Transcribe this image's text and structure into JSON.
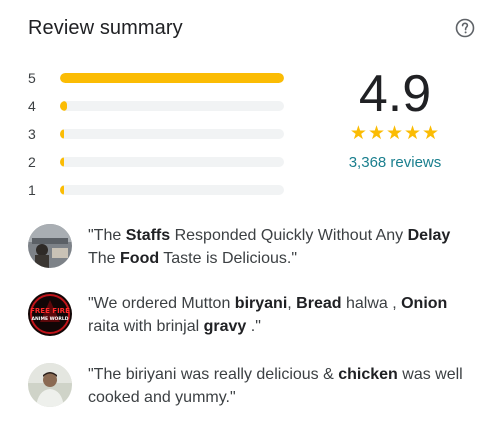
{
  "header": {
    "title": "Review summary",
    "help_icon": "question-circle-icon"
  },
  "rating_distribution": [
    {
      "stars": "5",
      "fraction": 1.0
    },
    {
      "stars": "4",
      "fraction": 0.03
    },
    {
      "stars": "3",
      "fraction": 0.005
    },
    {
      "stars": "2",
      "fraction": 0.005
    },
    {
      "stars": "1",
      "fraction": 0.005
    }
  ],
  "summary": {
    "average": "4.9",
    "stars_display": "★★★★★",
    "review_count": "3,368 reviews"
  },
  "colors": {
    "bar_fill": "#fbbc04",
    "bar_track": "#f1f3f4",
    "link": "#1a7f8e"
  },
  "reviews": [
    {
      "avatar_icon": "user-photo-avatar",
      "segments": [
        {
          "text": "\"The ",
          "bold": false
        },
        {
          "text": "Staffs",
          "bold": true
        },
        {
          "text": " Responded Quickly Without Any ",
          "bold": false
        },
        {
          "text": "Delay",
          "bold": true
        },
        {
          "text": " The ",
          "bold": false
        },
        {
          "text": "Food",
          "bold": true
        },
        {
          "text": " Taste is Delicious.\"",
          "bold": false
        }
      ]
    },
    {
      "avatar_icon": "free-fire-logo-avatar",
      "avatar_text": "FREE FIRE ANIME WORLD",
      "segments": [
        {
          "text": "\"We ordered Mutton ",
          "bold": false
        },
        {
          "text": "biryani",
          "bold": true
        },
        {
          "text": ", ",
          "bold": false
        },
        {
          "text": "Bread",
          "bold": true
        },
        {
          "text": " halwa , ",
          "bold": false
        },
        {
          "text": "Onion",
          "bold": true
        },
        {
          "text": " raita with brinjal ",
          "bold": false
        },
        {
          "text": "gravy",
          "bold": true
        },
        {
          "text": " .\"",
          "bold": false
        }
      ]
    },
    {
      "avatar_icon": "user-photo-avatar",
      "segments": [
        {
          "text": "\"The biriyani was really delicious & ",
          "bold": false
        },
        {
          "text": "chicken",
          "bold": true
        },
        {
          "text": " was well cooked and yummy.\"",
          "bold": false
        }
      ]
    }
  ]
}
